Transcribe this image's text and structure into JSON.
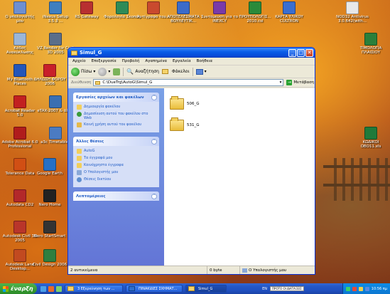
{
  "desktop": {
    "icons": [
      {
        "label": "Ο υπολογιστής μου",
        "color": "#6e8fd1"
      },
      {
        "label": "iNexus Setup 3.5.3 ...",
        "color": "#3f7fbf"
      },
      {
        "label": "RS Gateway",
        "color": "#b83030"
      },
      {
        "label": "Φορολογία Σκοπός",
        "color": "#2e8b57"
      },
      {
        "label": "Αντίγραφο του...",
        "color": "#c94a2e"
      },
      {
        "label": "ΑΠΟΤΕΛΕΣΜΑΤΑ ΒΟΥΛΕΥΤΙΚ...",
        "color": "#3b6bc9"
      },
      {
        "label": "Συντομευση για το INEXCY",
        "color": "#7a3aa8"
      },
      {
        "label": "ΠΡΟΥΠΟΛΟΓΙΣ... 2010.csl",
        "color": "#2a8a3a"
      },
      {
        "label": "ΚΑΡΤΑ ΥΛΙΚΟΥ CULTRON",
        "color": "#3a6ed0"
      },
      {
        "label": "NOD32 Antivirus 3.0.642(with...",
        "color": "#e8e8e8"
      },
      {
        "label": "Κάδος Ανακύκλωσης",
        "color": "#9bb6d8"
      },
      {
        "label": "VZ Render for Civil 3D 2005",
        "color": "#5a6e8a"
      },
      {
        "label": "ΤΙΜΟΛΟΓΙΑ ΠΛΑΙΣΙΟΥ",
        "color": "#2a7f3a"
      },
      {
        "label": "My Bluetooth Places",
        "color": "#2456b8"
      },
      {
        "label": "ΔΗΛΩΣΗ ΦΟΡΟΥ 2006",
        "color": "#c8202a"
      },
      {
        "label": "Acrobat Reader 5.0",
        "color": "#c22020"
      },
      {
        "label": "eTAX-2007 & άλλα",
        "color": "#3a6fb2"
      },
      {
        "label": "Adobe Acrobat 6.0 Professional",
        "color": "#b01c1c"
      },
      {
        "label": "a3c Timetables",
        "color": "#4b7bc2"
      },
      {
        "label": "ΚΩΔΙΚΟΙ ΟΒΟ11.xls",
        "color": "#1f7a3a"
      },
      {
        "label": "Tolerance Data",
        "color": "#d14f14"
      },
      {
        "label": "Google Earth",
        "color": "#2570c6"
      },
      {
        "label": "Autodata CD2",
        "color": "#b3282a"
      },
      {
        "label": "Nero Home",
        "color": "#222222"
      },
      {
        "label": "Autodesk Civil 3D 2005",
        "color": "#b9352a"
      },
      {
        "label": "Nero StartSmart",
        "color": "#333333"
      },
      {
        "label": "Autodesk Land Desktop...",
        "color": "#c24a20"
      },
      {
        "label": "Civil Design 2006",
        "color": "#2f7f3f"
      }
    ]
  },
  "window": {
    "title": "Simul_G",
    "controls": {
      "minimize": "_",
      "maximize": "□",
      "close": "✕"
    },
    "menu": [
      "Αρχείο",
      "Επεξεργασία",
      "Προβολή",
      "Αγαπημένα",
      "Εργαλεία",
      "Βοήθεια"
    ],
    "toolbar": {
      "back": "Πίσω",
      "search": "Αναζήτηση",
      "folders": "Φάκελοι"
    },
    "address": {
      "label": "Διεύθυνση",
      "value": "C:\\DueTrg\\AutoG\\Simul_G",
      "go": "Μετάβαση"
    },
    "taskpane": {
      "file_tasks": {
        "title": "Εργασίες αρχείων και φακέλων",
        "items": [
          "Δημιουργία φακέλου",
          "Δημοσίευση αυτού του φακέλου στο Web",
          "Κοινή χρήση αυτού του φακέλου"
        ]
      },
      "other_places": {
        "title": "Άλλες θέσεις",
        "items": [
          "AutoG",
          "Τα έγγραφά μου",
          "Κοινόχρηστα έγγραφα",
          "Ο Υπολογιστής μου",
          "Θέσεις δικτύου"
        ]
      },
      "details": {
        "title": "Λεπτομέρειες"
      }
    },
    "files": [
      {
        "name": "506_G"
      },
      {
        "name": "531_G"
      }
    ],
    "status": {
      "objects": "2 αντικείμενα",
      "size": "0 byte",
      "location": "Ο Υπολογιστής μου"
    }
  },
  "taskbar": {
    "start": "έναρξη",
    "buttons": [
      {
        "label": "3 Εξερεύνηση των ...",
        "active": false
      },
      {
        "label": "ΠΙΝΑΚΙΔΕΣ ΣΧΗΜΑΤ...",
        "active": false
      },
      {
        "label": "Simul_G",
        "active": true
      }
    ],
    "lang": "EN",
    "tray_box": "ΠΡΟΤΟ ΟΙ ΔΙΑΤΑΞΕΙΣ",
    "clock": "10:56 πμ"
  }
}
